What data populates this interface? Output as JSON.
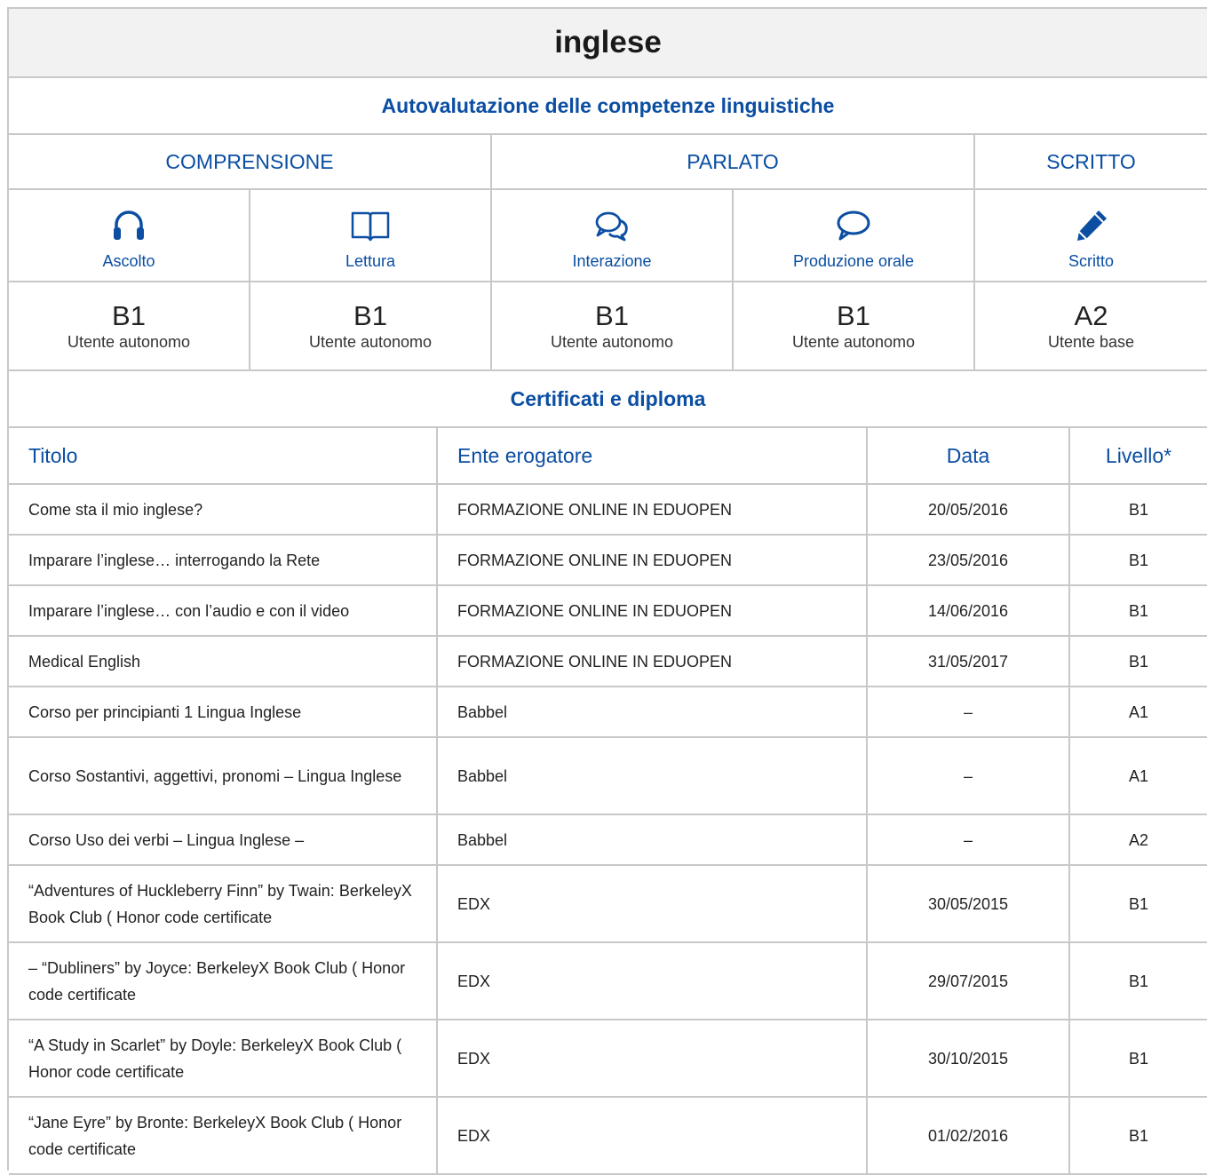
{
  "language": "inglese",
  "self_assessment": {
    "heading": "Autovalutazione delle competenze linguistiche",
    "groups": [
      "COMPRENSIONE",
      "PARLATO",
      "SCRITTO"
    ],
    "skills": [
      {
        "icon": "headphones-icon",
        "label": "Ascolto",
        "level": "B1",
        "desc": "Utente autonomo"
      },
      {
        "icon": "book-icon",
        "label": "Lettura",
        "level": "B1",
        "desc": "Utente autonomo"
      },
      {
        "icon": "chat-bubbles-icon",
        "label": "Interazione",
        "level": "B1",
        "desc": "Utente autonomo"
      },
      {
        "icon": "speech-bubble-icon",
        "label": "Produzione orale",
        "level": "B1",
        "desc": "Utente autonomo"
      },
      {
        "icon": "pencil-icon",
        "label": "Scritto",
        "level": "A2",
        "desc": "Utente base"
      }
    ],
    "accent_color": "#0b4ea2"
  },
  "certificates": {
    "heading": "Certificati e diploma",
    "columns": [
      "Titolo",
      "Ente erogatore",
      "Data",
      "Livello*"
    ],
    "rows": [
      [
        "Come sta il mio inglese?",
        "FORMAZIONE ONLINE IN EDUOPEN",
        "20/05/2016",
        "B1"
      ],
      [
        "Imparare l’inglese… interrogando la Rete",
        "FORMAZIONE ONLINE IN EDUOPEN",
        "23/05/2016",
        "B1"
      ],
      [
        "Imparare l’inglese… con l’audio e con il video",
        "FORMAZIONE ONLINE IN EDUOPEN",
        "14/06/2016",
        "B1"
      ],
      [
        "Medical English",
        "FORMAZIONE ONLINE IN EDUOPEN",
        "31/05/2017",
        "B1"
      ],
      [
        "Corso per principianti 1 Lingua Inglese",
        "Babbel",
        "–",
        "A1"
      ],
      [
        "Corso Sostantivi, aggettivi, pronomi – Lingua Inglese",
        "Babbel",
        "–",
        "A1"
      ],
      [
        "Corso Uso dei verbi – Lingua Inglese –",
        "Babbel",
        "–",
        "A2"
      ],
      [
        "“Adventures of Huckleberry Finn” by Twain: BerkeleyX Book Club ( Honor code certificate",
        "EDX",
        "30/05/2015",
        "B1"
      ],
      [
        "– “Dubliners” by Joyce: BerkeleyX Book Club ( Honor code certificate",
        "EDX",
        "29/07/2015",
        "B1"
      ],
      [
        "“A Study in Scarlet” by Doyle: BerkeleyX Book Club ( Honor code certificate",
        "EDX",
        "30/10/2015",
        "B1"
      ],
      [
        "“Jane Eyre” by Bronte: BerkeleyX Book Club ( Honor code certificate",
        "EDX",
        "01/02/2016",
        "B1"
      ]
    ]
  }
}
